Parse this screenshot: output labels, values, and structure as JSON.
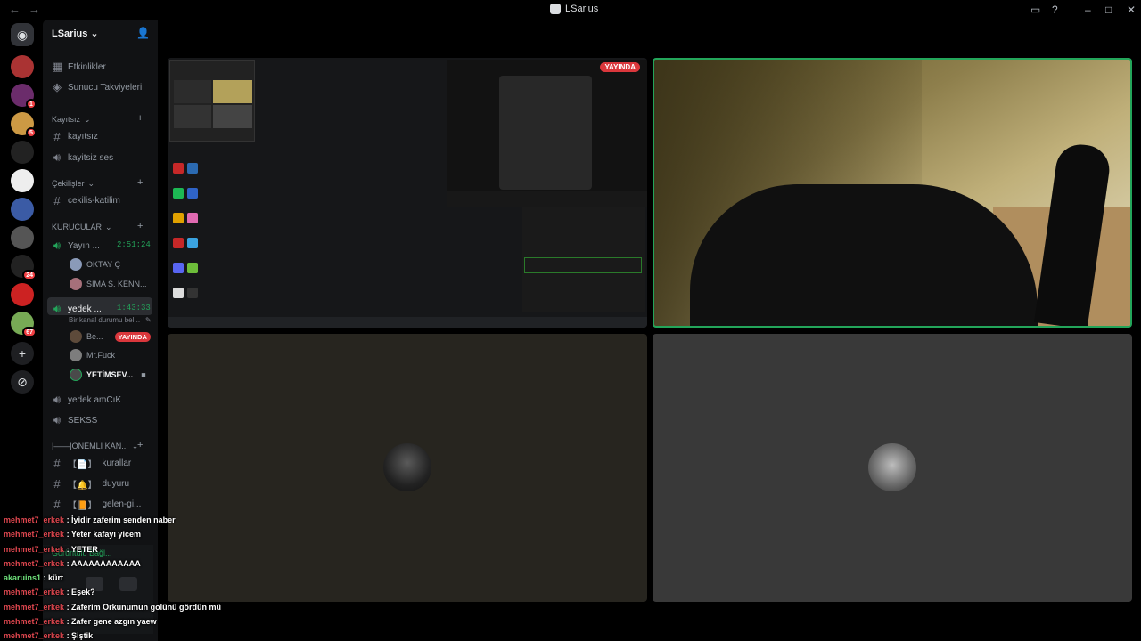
{
  "window": {
    "title": "LSarius",
    "back": "←",
    "forward": "→"
  },
  "server": {
    "name": "LSarius"
  },
  "sidebar": {
    "top_items": [
      {
        "label": "Etkinlikler"
      },
      {
        "label": "Sunucu Takviyeleri"
      }
    ],
    "categories": [
      {
        "label": "Kayıtsız",
        "channels": [
          {
            "type": "text",
            "label": "kayıtsız"
          },
          {
            "type": "voice",
            "label": "kayitsiz ses"
          }
        ]
      },
      {
        "label": "Çekilişler",
        "channels": [
          {
            "type": "text",
            "label": "cekilis-katilim"
          }
        ]
      },
      {
        "label": "KURUCULAR",
        "channels": [
          {
            "type": "voice",
            "label": "Yayın ...",
            "timer": "2:51:24",
            "members": [
              "OKTAY Ç",
              "SİMA S. KENN..."
            ]
          },
          {
            "type": "voice",
            "label": "yedek ...",
            "timer": "1:43:33",
            "status": "Bir kanal durumu bel...",
            "members": [
              "Be...",
              "Mr.Fuck",
              "YETİMSEV..."
            ],
            "live_label": "YAYINDA"
          },
          {
            "type": "voice",
            "label": "yedek amCıK"
          },
          {
            "type": "voice",
            "label": "SEKSS"
          }
        ]
      },
      {
        "label": "|——|ÖNEMLİ KAN...",
        "channels": [
          {
            "type": "text",
            "label": "kurallar",
            "bracket": "【📄】"
          },
          {
            "type": "text",
            "label": "duyuru",
            "bracket": "【🔔】"
          },
          {
            "type": "text",
            "label": "gelen-gi...",
            "bracket": "【📙】"
          }
        ]
      }
    ]
  },
  "voice_panel": {
    "status": "Görüntülü Bağl..."
  },
  "badges": {
    "s2": "1",
    "s4": "5",
    "s8": "24",
    "s10": "67"
  },
  "stage": {
    "live_label": "YAYINDA"
  },
  "chat_overlay": [
    {
      "user": "mehmet7_erkek",
      "msg": ": İyidir zaferim senden naber"
    },
    {
      "user": "mehmet7_erkek",
      "msg": ": Yeter kafayı yicem"
    },
    {
      "user": "mehmet7_erkek",
      "msg": ": YETER"
    },
    {
      "user": "mehmet7_erkek",
      "msg": ": AAAAAAAAAAAA"
    },
    {
      "user": "akaruins1",
      "msg": ": kürt",
      "green": true
    },
    {
      "user": "mehmet7_erkek",
      "msg": ": Eşek?"
    },
    {
      "user": "mehmet7_erkek",
      "msg": ": Zaferim Orkunumun golünü gördün mü"
    },
    {
      "user": "mehmet7_erkek",
      "msg": ": Zafer gene azgın yaew"
    },
    {
      "user": "mehmet7_erkek",
      "msg": ": Şiştik"
    }
  ]
}
